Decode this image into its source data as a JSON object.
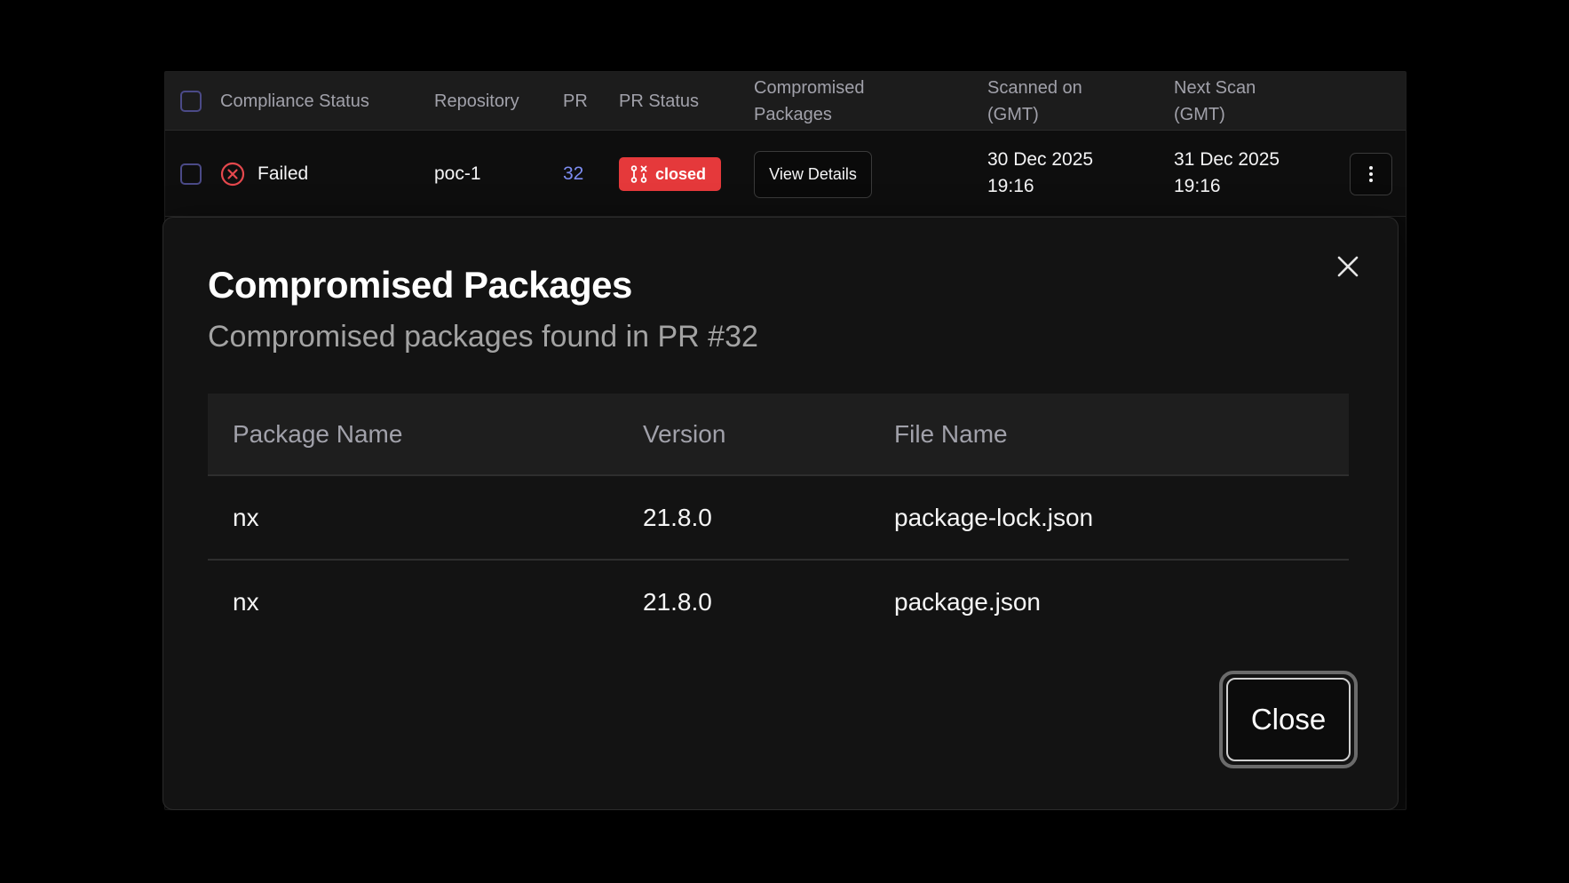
{
  "table": {
    "headers": {
      "compliance_status": "Compliance Status",
      "repository": "Repository",
      "pr": "PR",
      "pr_status": "PR Status",
      "compromised_packages_1": "Compromised",
      "compromised_packages_2": "Packages",
      "scanned_on_1": "Scanned on",
      "scanned_on_2": "(GMT)",
      "next_scan_1": "Next Scan",
      "next_scan_2": "(GMT)"
    },
    "row": {
      "status": "Failed",
      "repository": "poc-1",
      "pr": "32",
      "pr_status": "closed",
      "view_details": "View Details",
      "scanned_date": "30 Dec 2025",
      "scanned_time": "19:16",
      "next_date": "31 Dec 2025",
      "next_time": "19:16"
    }
  },
  "modal": {
    "title": "Compromised Packages",
    "subtitle": "Compromised packages found in PR #32",
    "columns": {
      "package_name": "Package Name",
      "version": "Version",
      "file_name": "File Name"
    },
    "rows": [
      {
        "package_name": "nx",
        "version": "21.8.0",
        "file_name": "package-lock.json"
      },
      {
        "package_name": "nx",
        "version": "21.8.0",
        "file_name": "package.json"
      }
    ],
    "close_label": "Close"
  },
  "colors": {
    "failed": "#e5484d",
    "badge_closed": "#e5393b",
    "link": "#7c8cf0"
  },
  "icons": {
    "status": "x-circle-icon",
    "pr_status": "git-pull-request-closed-icon",
    "modal_close": "close-icon",
    "row_actions": "more-vertical-icon"
  }
}
